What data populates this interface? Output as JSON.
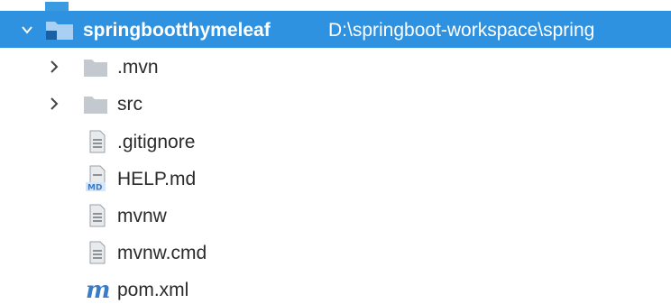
{
  "project_tree": {
    "root": {
      "name": "springbootthymeleaf",
      "path": "D:\\springboot-workspace\\spring",
      "expanded": true,
      "selected": true
    },
    "items": [
      {
        "label": ".mvn",
        "type": "folder",
        "collapsed": true,
        "icon": "folder-icon"
      },
      {
        "label": "src",
        "type": "folder",
        "collapsed": true,
        "icon": "folder-icon"
      },
      {
        "label": ".gitignore",
        "type": "file",
        "icon": "text-file-icon"
      },
      {
        "label": "HELP.md",
        "type": "file",
        "icon": "markdown-file-icon",
        "badge": "MD"
      },
      {
        "label": "mvnw",
        "type": "file",
        "icon": "text-file-icon"
      },
      {
        "label": "mvnw.cmd",
        "type": "file",
        "icon": "text-file-icon"
      },
      {
        "label": "pom.xml",
        "type": "file",
        "icon": "maven-pom-icon",
        "badge": "m"
      }
    ]
  },
  "colors": {
    "selection": "#2f92e0",
    "folder": "#bfc6cc",
    "file": "#9aa0a6",
    "md_badge": "#3a7cc7",
    "maven": "#3a7cc7"
  }
}
